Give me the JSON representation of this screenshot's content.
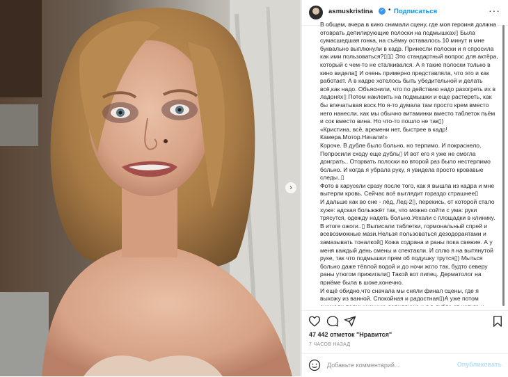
{
  "post": {
    "username": "asmuskristina",
    "follow_label": "Подписаться",
    "dot": "•",
    "more_glyph": "···",
    "caption_lines": [
      "В общем, вчера в кино снимали сцену, где моя героиня должна отоврать депилирующие полоски на подмышках▯ Была сумасшедшая гонка, на съёмку оставалось 10 минут и мне буквально выплюнули в кадр. Принесли полоски и я спросила как ими пользоваться?▯▯▯ Это стандартный вопрос для актёра, который с чем-то не сталкивался. А я такие полоски только в кино видела▯ И очень примерно представляла, что это и как работает. А в кадре хотелось быть убедительной и делать всё,как надо. Объяснили, что по действию надо разогреть их в ладонях▯ Потом наклеить на подмышки и еще растереть, как бы впечатывая воск.Но я-то думала там просто крем вместо него нанесли, как мы обычно витаминки вместо таблеток пьём и сок вместо вина. Но что-то пошло не так▯)",
      "«Кристина, всё, времени нет, быстрее в кадр!",
      "Камера.Мотор.Начали!»",
      "Короче. В дубле было больно, но терпимо. И покраснело. Попросили сходу еще дубль▯ И вот его я уже не смогла доиграть.. Оторвать полоски во второй раз было нестерпимо больно. И когда я убрала руку, я увидела просто кровавые следы..▯",
      "Фото в карусели сразу после того, как я вышла из кадра и мне вытерли кровь. Сейчас всё выглядит гораздо страшнее▯",
      "И дальше как во сне - лёд, Лед-2▯, перекись, от которой стало хуже: адская больжжёт так, что можно сойти с ума: руки трясутся, одежду надеть больно.Уехали с площадки в клинику. В итоге ожоги..▯ Выписали таблетки, гормональный спрей и всевозможные мази.Нельзя пользоваться дезодорантами и замазывать тоналкой▯ Кожа содрана и раны пока свежие. А у меня каждый день смены и спектакли. И сплю я на вытянутой руке, так что подмышки прям об подушку трутся▯) Мыться больно даже тёплой водой и до ночи жгло так, будто северу раны утюгом прижигали▯ Такой вот пипец. Дерматолог на приёме была в шоке,конечно.",
      "И ещё обидно,что сначала мы сняли финал сцены, где я выхожу из ванной. Спокойная и радостная▯)А уже потом снимали подмышечную депиляцию и я в дубле от испуга и боли по-настоящему закричала и разрыдалась. Жанр моментально из комедии на хоррор поменялся▯)Короче, не знаю как это"
    ],
    "likes": "47 442 отметок \"Нравится\"",
    "time": "7 ЧАСОВ НАЗАД",
    "comment_placeholder": "Добавьте комментарий...",
    "publish_label": "Опубликовать"
  },
  "icons": {
    "avatar": "avatar",
    "verified": "verified-badge-icon",
    "heart": "heart-icon",
    "comment": "comment-icon",
    "share": "share-icon",
    "save": "bookmark-icon",
    "emoji": "emoji-icon",
    "carousel_next": "chevron-right-icon"
  },
  "colors": {
    "accent": "#0095f6",
    "verified": "#3897f0",
    "publish_disabled": "#b2dffc"
  }
}
